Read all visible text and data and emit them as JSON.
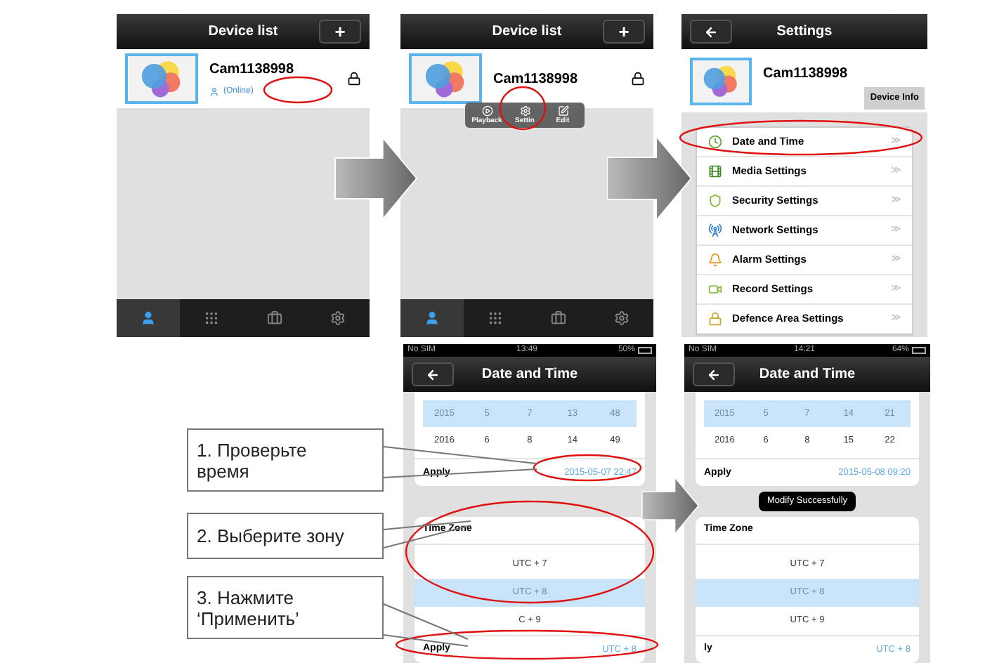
{
  "device_list_screens": [
    {
      "title": "Device list",
      "add": "+",
      "device_name": "Cam1138998",
      "status": "(Online)",
      "tabs": [
        {
          "selected": true
        },
        {
          "selected": false
        },
        {
          "selected": false
        },
        {
          "selected": false
        }
      ]
    },
    {
      "title": "Device list",
      "add": "+",
      "device_name": "Cam1138998",
      "popup": [
        {
          "label": "Playback",
          "kind": "play"
        },
        {
          "label": "Settin",
          "kind": "gear"
        },
        {
          "label": "Edit",
          "kind": "edit"
        }
      ],
      "tabs": [
        {
          "selected": true
        },
        {
          "selected": false
        },
        {
          "selected": false
        },
        {
          "selected": false
        }
      ]
    }
  ],
  "settings_screen": {
    "title": "Settings",
    "device_name": "Cam1138998",
    "device_info": "Device Info",
    "items": [
      {
        "label": "Date and Time",
        "kind": "clock",
        "more": "≫"
      },
      {
        "label": "Media Settings",
        "kind": "media",
        "more": "≫"
      },
      {
        "label": "Security Settings",
        "kind": "shield",
        "more": "≫"
      },
      {
        "label": "Network Settings",
        "kind": "network",
        "more": "≫"
      },
      {
        "label": "Alarm Settings",
        "kind": "alarm",
        "more": "≫"
      },
      {
        "label": "Record Settings",
        "kind": "record",
        "more": "≫"
      },
      {
        "label": "Defence Area Settings",
        "kind": "lock",
        "more": "≫"
      }
    ]
  },
  "date_screens": [
    {
      "carrier": "No SIM",
      "time": "13:49",
      "battery": "50%",
      "title": "Date and Time",
      "rows": [
        {
          "cells": [
            "2015",
            "5",
            "7",
            "13",
            "48"
          ],
          "selected": true
        },
        {
          "cells": [
            "2016",
            "6",
            "8",
            "14",
            "49"
          ],
          "selected": false
        }
      ],
      "apply": "Apply",
      "current": "2015-05-07 22:47",
      "zone_title": "Time Zone",
      "zones": [
        {
          "label": "UTC + 7",
          "selected": false
        },
        {
          "label": "UTC + 8",
          "selected": true
        },
        {
          "label": "C + 9",
          "selected": false
        }
      ],
      "zone_apply": "Apply",
      "zone_current": "UTC + 8"
    },
    {
      "carrier": "No SIM",
      "time": "14:21",
      "battery": "64%",
      "title": "Date and Time",
      "rows": [
        {
          "cells": [
            "2015",
            "5",
            "7",
            "14",
            "21"
          ],
          "selected": true
        },
        {
          "cells": [
            "2016",
            "6",
            "8",
            "15",
            "22"
          ],
          "selected": false
        }
      ],
      "apply": "Apply",
      "current": "2015-05-08 09:20",
      "toast": "Modify Successfully",
      "zone_title": "Time Zone",
      "zones": [
        {
          "label": "UTC + 7",
          "selected": false
        },
        {
          "label": "UTC + 8",
          "selected": true
        },
        {
          "label": "UTC + 9",
          "selected": false
        }
      ],
      "zone_apply": "ly",
      "zone_current": "UTC + 8"
    }
  ],
  "callouts": [
    {
      "text": "1. Проверьте время"
    },
    {
      "text": "2. Выберите зону"
    },
    {
      "text": "3. Нажмите ‘Применить’"
    }
  ]
}
